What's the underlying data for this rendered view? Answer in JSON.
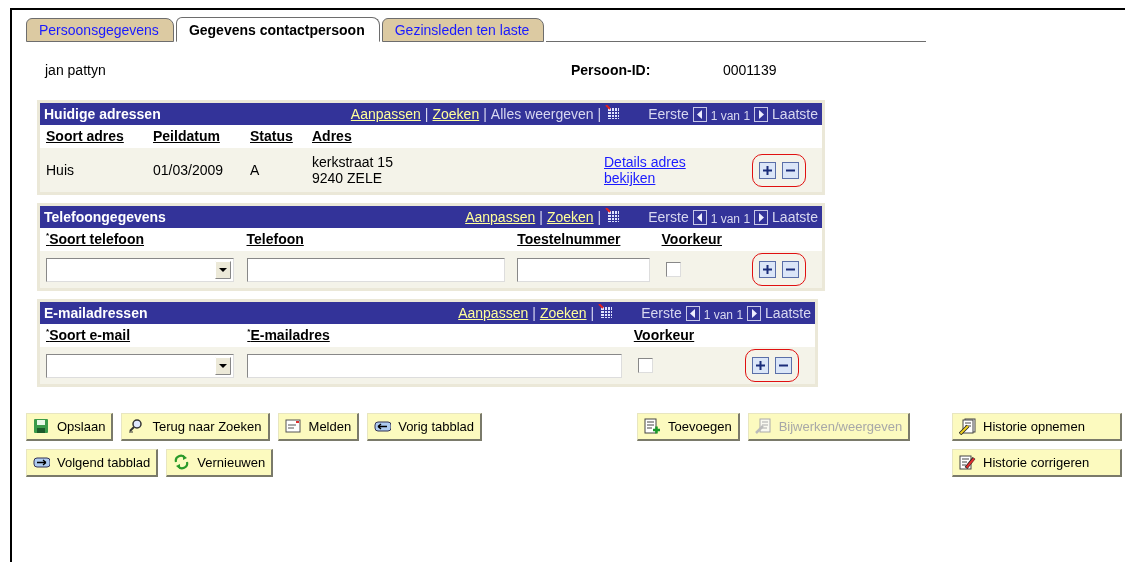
{
  "tabs": [
    {
      "label": "Persoonsgegevens",
      "selected": false
    },
    {
      "label": "Gegevens contactpersoon",
      "selected": true
    },
    {
      "label": "Gezinsleden ten laste",
      "selected": false
    }
  ],
  "person": {
    "name": "jan pattyn",
    "id_label": "Persoon-ID:",
    "id_value": "0001139"
  },
  "grids": [
    {
      "kind": "addresses",
      "title": "Huidige adressen",
      "links": [
        {
          "label": "Aanpassen",
          "disabled": false,
          "separator": "|"
        },
        {
          "label": "Zoeken",
          "disabled": false,
          "separator": "|"
        },
        {
          "label": "Alles weergeven",
          "disabled": true,
          "separator": "|"
        }
      ],
      "nav": {
        "first": "Eerste",
        "count": "1 van 1",
        "last": "Laatste"
      },
      "columns": [
        "Soort adres",
        "Peildatum",
        "Status",
        "Adres"
      ],
      "rows": [
        {
          "cells": [
            {
              "kind": "text",
              "lines": [
                "Huis"
              ]
            },
            {
              "kind": "text",
              "lines": [
                "01/03/2009"
              ]
            },
            {
              "kind": "text",
              "lines": [
                "A"
              ]
            },
            {
              "kind": "text",
              "lines": [
                "kerkstraat 15",
                "9240 ZELE"
              ]
            },
            {
              "kind": "link",
              "label": "Details adres bekijken"
            }
          ],
          "highlighted": true
        }
      ]
    },
    {
      "kind": "phones",
      "title": "Telefoongegevens",
      "links": [
        {
          "label": "Aanpassen",
          "disabled": false,
          "separator": "|"
        },
        {
          "label": "Zoeken",
          "disabled": false,
          "separator": "|"
        }
      ],
      "nav": {
        "first": "Eerste",
        "count": "1 van 1",
        "last": "Laatste"
      },
      "columns": [
        "$^{*}$Soort telefoon",
        "Telefoon",
        "Toestelnummer",
        "Voorkeur"
      ],
      "rows": [
        {
          "cells": [
            {
              "kind": "select"
            },
            {
              "kind": "input"
            },
            {
              "kind": "input"
            },
            {
              "kind": "checkbox",
              "checked": false
            }
          ],
          "highlighted": true
        }
      ]
    },
    {
      "kind": "emails",
      "title": "E-mailadressen",
      "links": [
        {
          "label": "Aanpassen",
          "disabled": false,
          "separator": "|"
        },
        {
          "label": "Zoeken",
          "disabled": false,
          "separator": "|"
        }
      ],
      "nav": {
        "first": "Eerste",
        "count": "1 van 1",
        "last": "Laatste"
      },
      "columns": [
        "$^{*}$Soort e-mail",
        "$^{*}$E-mailadres",
        "Voorkeur"
      ],
      "rows": [
        {
          "cells": [
            {
              "kind": "select"
            },
            {
              "kind": "input"
            },
            {
              "kind": "checkbox",
              "checked": false
            }
          ],
          "highlighted": true
        }
      ]
    }
  ],
  "buttons": {
    "left": [
      [
        {
          "label": "Opslaan",
          "kind": "save",
          "disabled": false
        },
        {
          "label": "Terug naar Zoeken",
          "kind": "search",
          "disabled": false
        },
        {
          "label": "Melden",
          "kind": "notify",
          "disabled": false
        },
        {
          "label": "Vorig tabblad",
          "kind": "prev",
          "disabled": false
        }
      ],
      [
        {
          "label": "Volgend tabblad",
          "kind": "next",
          "disabled": false
        },
        {
          "label": "Vernieuwen",
          "kind": "refresh",
          "disabled": false
        }
      ]
    ],
    "middle": [
      {
        "label": "Toevoegen",
        "kind": "add",
        "disabled": false
      },
      {
        "label": "Bijwerken/weergeven",
        "kind": "edit",
        "disabled": true
      }
    ],
    "right": [
      {
        "label": "Historie opnemen",
        "kind": "history",
        "disabled": false
      },
      {
        "label": "Historie corrigeren",
        "kind": "correct",
        "disabled": false
      }
    ]
  }
}
